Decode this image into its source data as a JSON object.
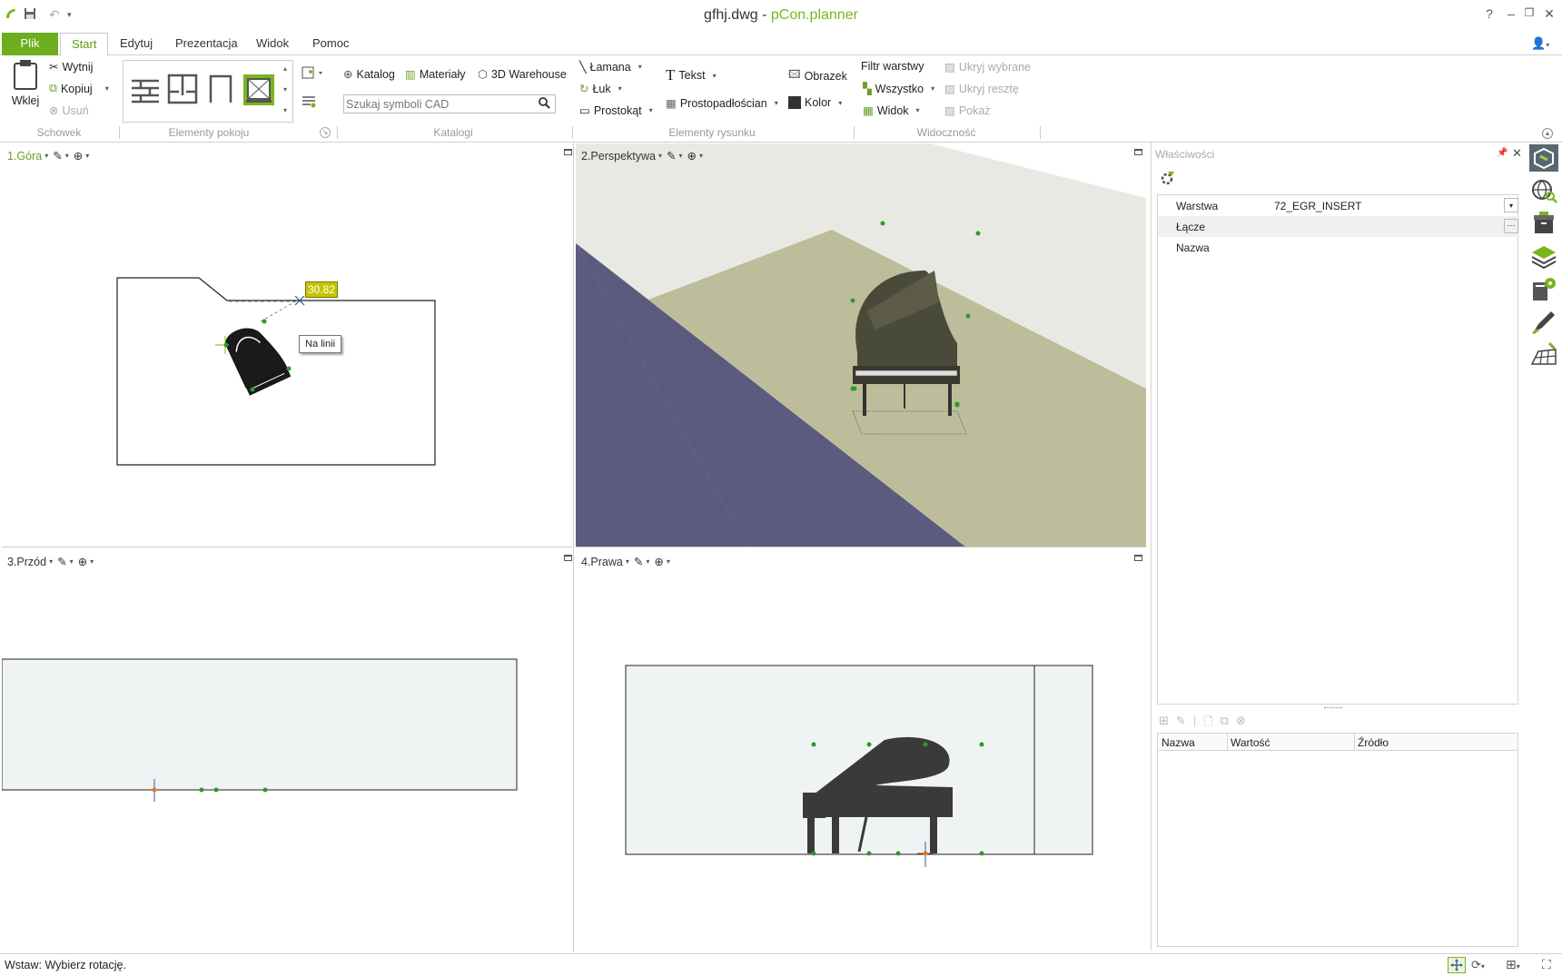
{
  "window": {
    "filename": "gfhj.dwg",
    "separator": " - ",
    "app_name": "pCon.planner",
    "help": "?"
  },
  "tabs": [
    {
      "label": "Plik"
    },
    {
      "label": "Start"
    },
    {
      "label": "Edytuj"
    },
    {
      "label": "Prezentacja"
    },
    {
      "label": "Widok"
    },
    {
      "label": "Pomoc"
    }
  ],
  "ribbon": {
    "clipboard": {
      "paste": "Wklej",
      "cut": "Wytnij",
      "copy": "Kopiuj",
      "delete": "Usuń",
      "group": "Schowek"
    },
    "room": {
      "group": "Elementy pokoju"
    },
    "catalogs": {
      "catalog": "Katalog",
      "materials": "Materiały",
      "warehouse": "3D Warehouse",
      "search_placeholder": "Szukaj symboli CAD",
      "group": "Katalogi"
    },
    "drawing": {
      "polyline": "Łamana",
      "arc": "Łuk",
      "rect": "Prostokąt",
      "text": "Tekst",
      "box": "Prostopadłościan",
      "image": "Obrazek",
      "color": "Kolor",
      "group": "Elementy rysunku"
    },
    "visibility": {
      "filter": "Filtr warstwy",
      "all": "Wszystko",
      "view": "Widok",
      "hide_sel": "Ukryj wybrane",
      "hide_rest": "Ukryj resztę",
      "show": "Pokaż",
      "group": "Widoczność"
    }
  },
  "viewports": {
    "top": {
      "label": "1.Góra",
      "dim_value": "30.82",
      "tooltip": "Na linii"
    },
    "persp": {
      "label": "2.Perspektywa"
    },
    "front": {
      "label": "3.Przód"
    },
    "right": {
      "label": "4.Prawa"
    }
  },
  "properties": {
    "title": "Właściwości",
    "rows": [
      {
        "key": "Warstwa",
        "value": "72_EGR_INSERT"
      },
      {
        "key": "Łącze",
        "value": ""
      },
      {
        "key": "Nazwa",
        "value": ""
      }
    ],
    "table_headers": [
      "Nazwa",
      "Wartość",
      "Źródło"
    ]
  },
  "status": {
    "text": "Wstaw: Wybierz rotację."
  },
  "colors": {
    "accent": "#7ab51d",
    "plik_tab": "#6cae1e",
    "wall": "#5b5b80",
    "floor": "#bfbf9c"
  }
}
